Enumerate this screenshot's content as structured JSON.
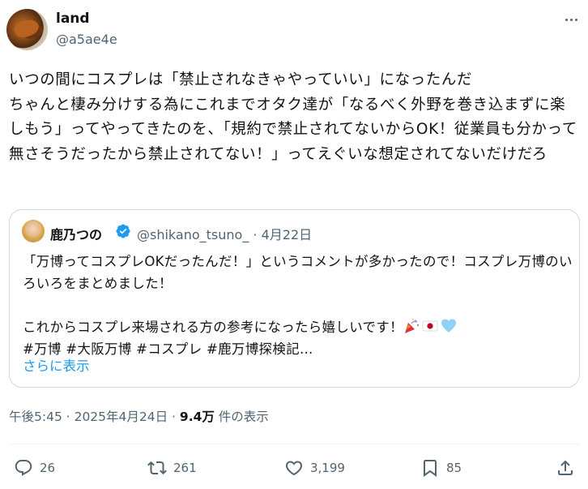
{
  "author": {
    "name": "land",
    "handle": "@a5ae4e"
  },
  "tweet": {
    "text": "いつの間にコスプレは「禁止されなきゃやっていい」になったんだ\nちゃんと棲み分けする為にこれまでオタク達が「なるべく外野を巻き込まずに楽しもう」ってやってきたのを、「規約で禁止されてないからOK！従業員も分かって無さそうだったから禁止されてない！」ってえぐいな想定されてないだけだろ"
  },
  "quote": {
    "name": "鹿乃つの",
    "handle_date": "@shikano_tsuno_ · 4月22日",
    "text": "「万博ってコスプレOKだったんだ！」というコメントが多かったので！コスプレ万博のいろいろをまとめました！\n\nこれからコスプレ来場される方の参考になったら嬉しいです！",
    "emojis": [
      "party-popper-icon",
      "japan-flag-icon",
      "light-blue-heart-icon"
    ],
    "hashtags": "#万博 #大阪万博 #コスプレ #鹿万博探検記…",
    "show_more": "さらに表示"
  },
  "meta": {
    "time": "午後5:45 · 2025年4月24日 · ",
    "views": "9.4万",
    "views_label": " 件の表示"
  },
  "actions": {
    "replies": "26",
    "retweets": "261",
    "likes": "3,199",
    "bookmarks": "85"
  },
  "colors": {
    "link": "#1d9bf0",
    "secondary": "#536471",
    "border": "#cfd9de"
  }
}
